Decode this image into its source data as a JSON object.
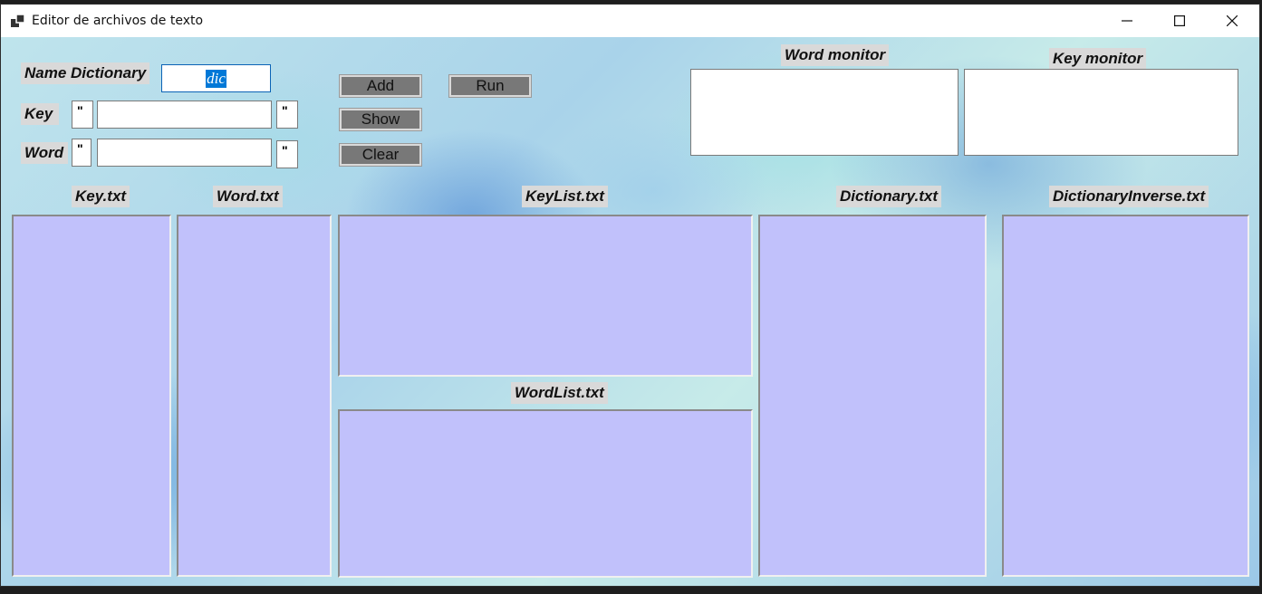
{
  "window": {
    "title": "Editor de archivos de texto",
    "icons": {
      "app": "app-icon",
      "minimize": "minimize-icon",
      "maximize": "maximize-icon",
      "close": "close-icon"
    }
  },
  "form": {
    "name_label": "Name Dictionary",
    "name_value": "dic",
    "key_label": "Key",
    "word_label": "Word",
    "quote_char": "\"",
    "key_value": "",
    "word_value": ""
  },
  "buttons": {
    "add": "Add",
    "run": "Run",
    "show": "Show",
    "clear": "Clear"
  },
  "monitors": {
    "word": "Word monitor",
    "key": "Key monitor"
  },
  "lists": {
    "key_txt": "Key.txt",
    "word_txt": "Word.txt",
    "keylist_txt": "KeyList.txt",
    "wordlist_txt": "WordList.txt",
    "dictionary_txt": "Dictionary.txt",
    "dictionary_inverse_txt": "DictionaryInverse.txt"
  },
  "colors": {
    "list_bg": "#c1c1fb",
    "button_bg": "#787878",
    "selection": "#0078d7"
  }
}
